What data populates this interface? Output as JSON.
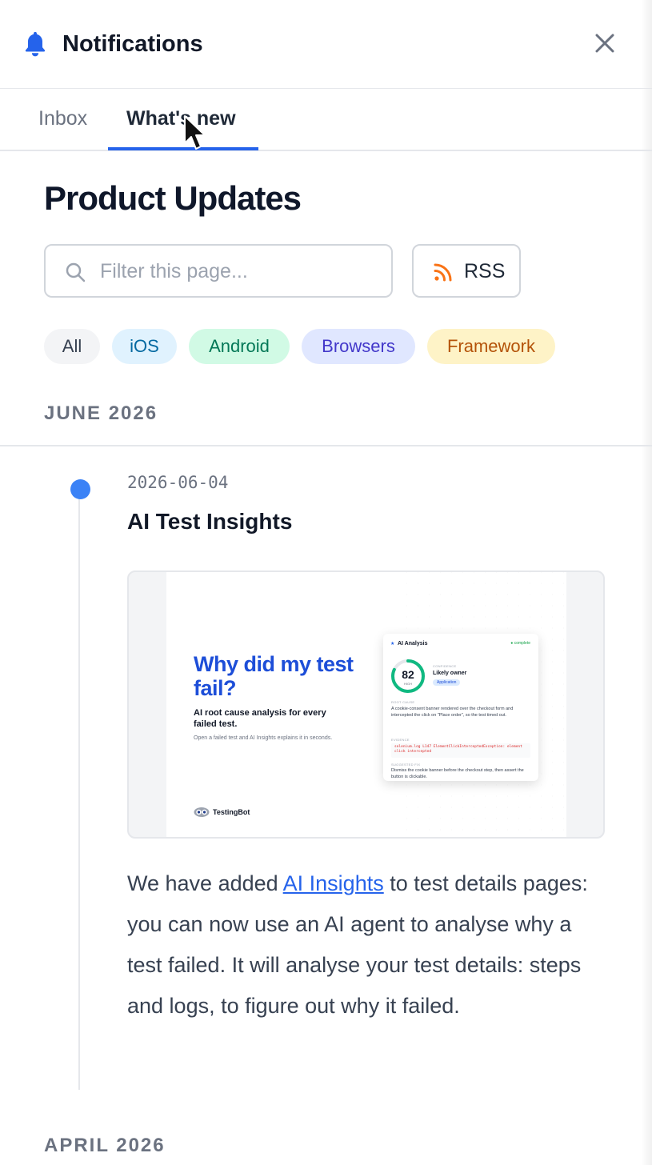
{
  "header": {
    "title": "Notifications"
  },
  "tabs": {
    "inbox": "Inbox",
    "whats_new": "What's new"
  },
  "page": {
    "title": "Product Updates"
  },
  "search": {
    "placeholder": "Filter this page..."
  },
  "rss": {
    "label": "RSS"
  },
  "filters": {
    "all": "All",
    "ios": "iOS",
    "android": "Android",
    "browsers": "Browsers",
    "framework": "Framework"
  },
  "months": {
    "june": "JUNE 2026",
    "april": "APRIL 2026"
  },
  "entry": {
    "date": "2026-06-04",
    "title": "AI Test Insights",
    "body_before": "We have added ",
    "link": "AI Insights",
    "body_after": " to test details pages: you can now use an AI agent to analyse why a test failed. It will analyse your test details: steps and logs, to figure out why it failed."
  },
  "promo": {
    "headline": "Why did my test fail?",
    "subheadline": "AI root cause analysis for every failed test.",
    "small": "Open a failed test and AI Insights explains it in seconds.",
    "brand": "TestingBot",
    "card": {
      "star": "★",
      "title": "AI Analysis",
      "status": "● complete",
      "score": "82",
      "score_label": "HIGH",
      "confidence_caption": "CONFIDENCE",
      "confidence_value": "Likely owner",
      "badge": "Application",
      "root_cause_caption": "ROOT CAUSE",
      "root_cause": "A cookie-consent banner rendered over the checkout form and intercepted the click on \"Place order\", so the test timed out.",
      "evidence_caption": "EVIDENCE",
      "evidence": "selenium.log L147  ElementClickInterceptedException: element click intercepted",
      "fix_caption": "SUGGESTED FIX",
      "fix": "Dismiss the cookie banner before the checkout step, then assert the button is clickable."
    }
  },
  "colors": {
    "accent": "#2563eb",
    "timeline_dot": "#3b82f6",
    "rss_orange": "#f97316",
    "gauge_green": "#10b981"
  },
  "icons": {
    "header": "bell-icon",
    "close": "close-icon",
    "search": "search-icon",
    "rss": "rss-icon",
    "cursor": "mouse-cursor-icon"
  }
}
